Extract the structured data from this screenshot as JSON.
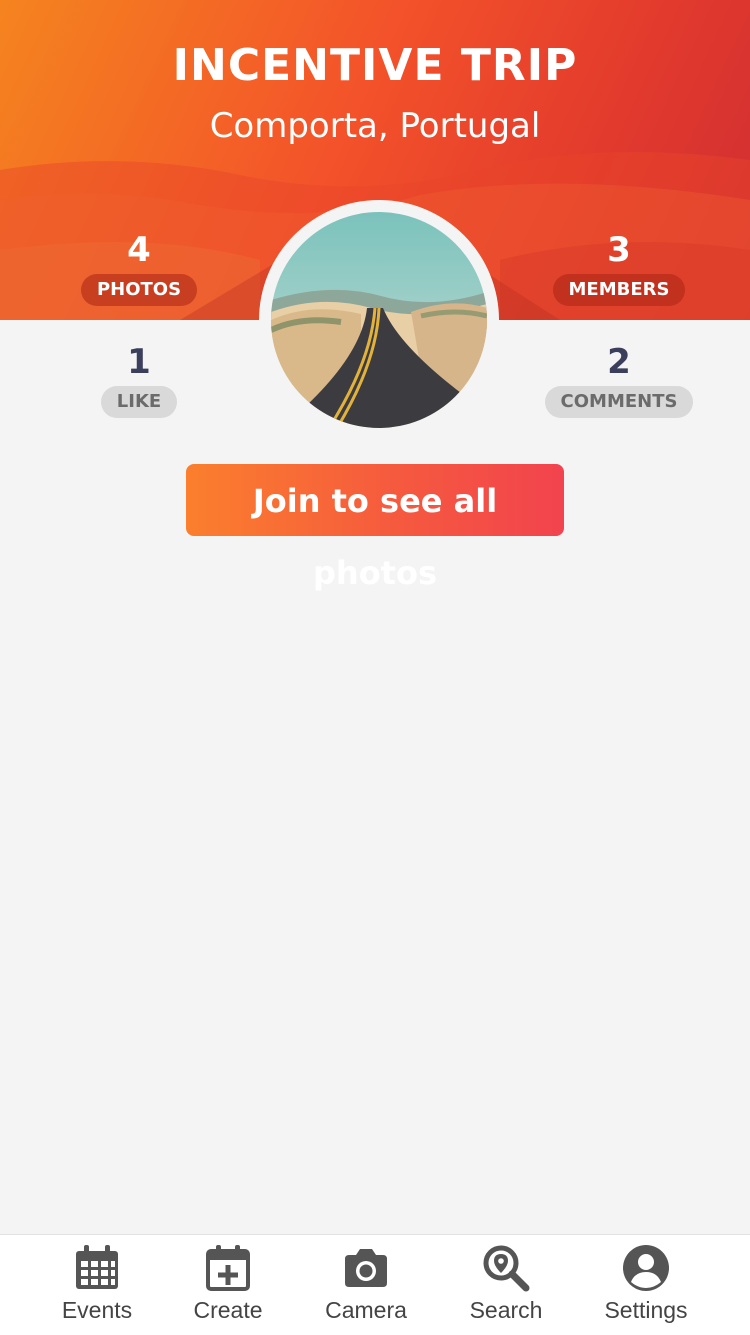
{
  "header": {
    "title": "INCENTIVE TRIP",
    "subtitle": "Comporta, Portugal"
  },
  "stats": {
    "photos": {
      "value": "4",
      "label": "PHOTOS"
    },
    "members": {
      "value": "3",
      "label": "MEMBERS"
    },
    "like": {
      "value": "1",
      "label": "LIKE"
    },
    "comments": {
      "value": "2",
      "label": "COMMENTS"
    }
  },
  "join_button": {
    "label": "Join to see all photos"
  },
  "tabbar": {
    "items": [
      {
        "label": "Events",
        "icon": "calendar-grid-icon"
      },
      {
        "label": "Create",
        "icon": "calendar-plus-icon"
      },
      {
        "label": "Camera",
        "icon": "camera-icon"
      },
      {
        "label": "Search",
        "icon": "location-search-icon"
      },
      {
        "label": "Settings",
        "icon": "account-circle-icon"
      }
    ]
  },
  "colors": {
    "hero_start": "#f5841f",
    "hero_end": "#cf2d33",
    "button_start": "#fb7f2d",
    "button_end": "#f2434e",
    "stat_number_dark": "#3b3f5c"
  }
}
